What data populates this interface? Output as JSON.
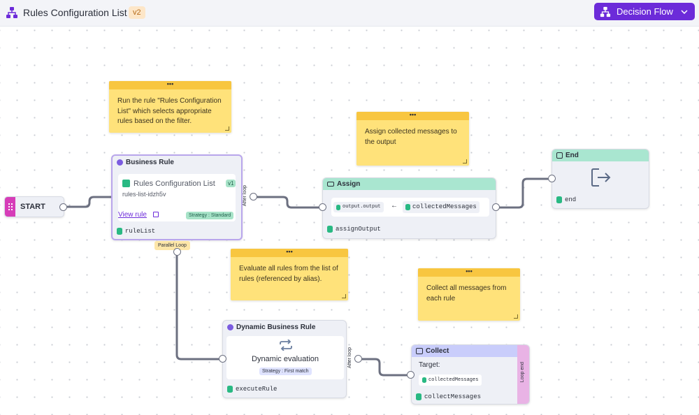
{
  "header": {
    "title": "Rules Configuration List",
    "version": "v2",
    "flow_button_label": "Decision Flow"
  },
  "notes": {
    "n1": "Run the rule \"Rules Configuration List\" which selects appropriate rules based on the filter.",
    "n2": "Assign collected messages to the output",
    "n3": "Evaluate all rules from the list of rules (referenced by alias).",
    "n4": "Collect all messages from each rule",
    "menu": "•••"
  },
  "start": {
    "label": "START"
  },
  "business_rule": {
    "header": "Business Rule",
    "rule_name": "Rules Configuration List",
    "rule_version": "v1",
    "rule_id": "rules-list-idzh5v",
    "view_link": "View rule",
    "strategy": "Strategy : Standard",
    "output_var": "ruleList",
    "loop_badge": "Parallel Loop",
    "after_loop": "After loop"
  },
  "assign": {
    "header": "Assign",
    "target": "output.output",
    "arrow": "←",
    "source": "collectedMessages",
    "output_var": "assignOutput"
  },
  "end": {
    "header": "End",
    "output_var": "end"
  },
  "dynamic": {
    "header": "Dynamic Business Rule",
    "title": "Dynamic evaluation",
    "strategy": "Strategy : First match",
    "output_var": "executeRule",
    "after_loop": "After loop"
  },
  "collect": {
    "header": "Collect",
    "target_label": "Target:",
    "target": "collectedMessages",
    "output_var": "collectMessages",
    "loop_end": "Loop end"
  },
  "colors": {
    "accent": "#6c2bd9",
    "assign_header": "#a9e6d0",
    "collect_header": "#c9cdfb",
    "loop_end": "#e9b3e5",
    "note": "#ffe27a"
  }
}
